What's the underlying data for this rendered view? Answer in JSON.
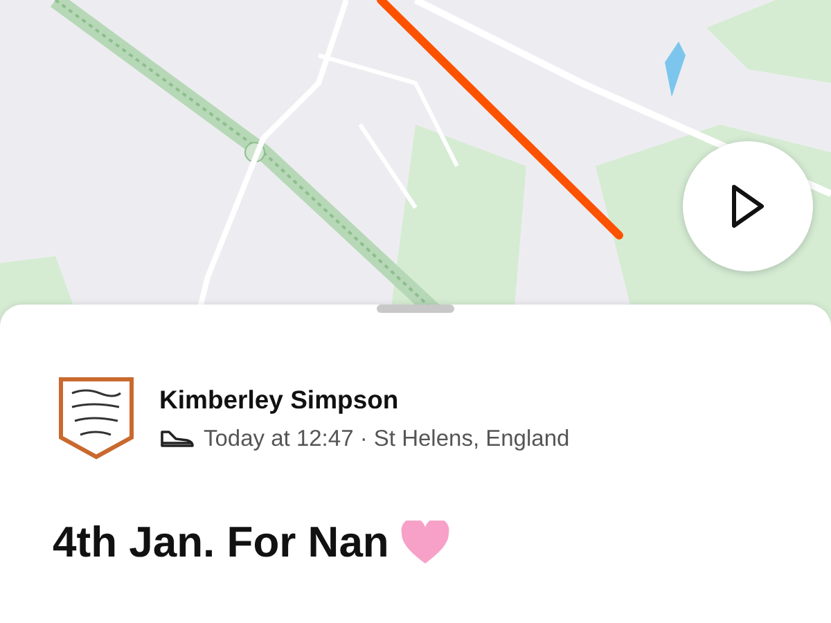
{
  "athlete": {
    "name": "Kimberley Simpson",
    "meta": "Today at 12:47 · St Helens, England"
  },
  "activity": {
    "title": "4th Jan. For Nan"
  }
}
